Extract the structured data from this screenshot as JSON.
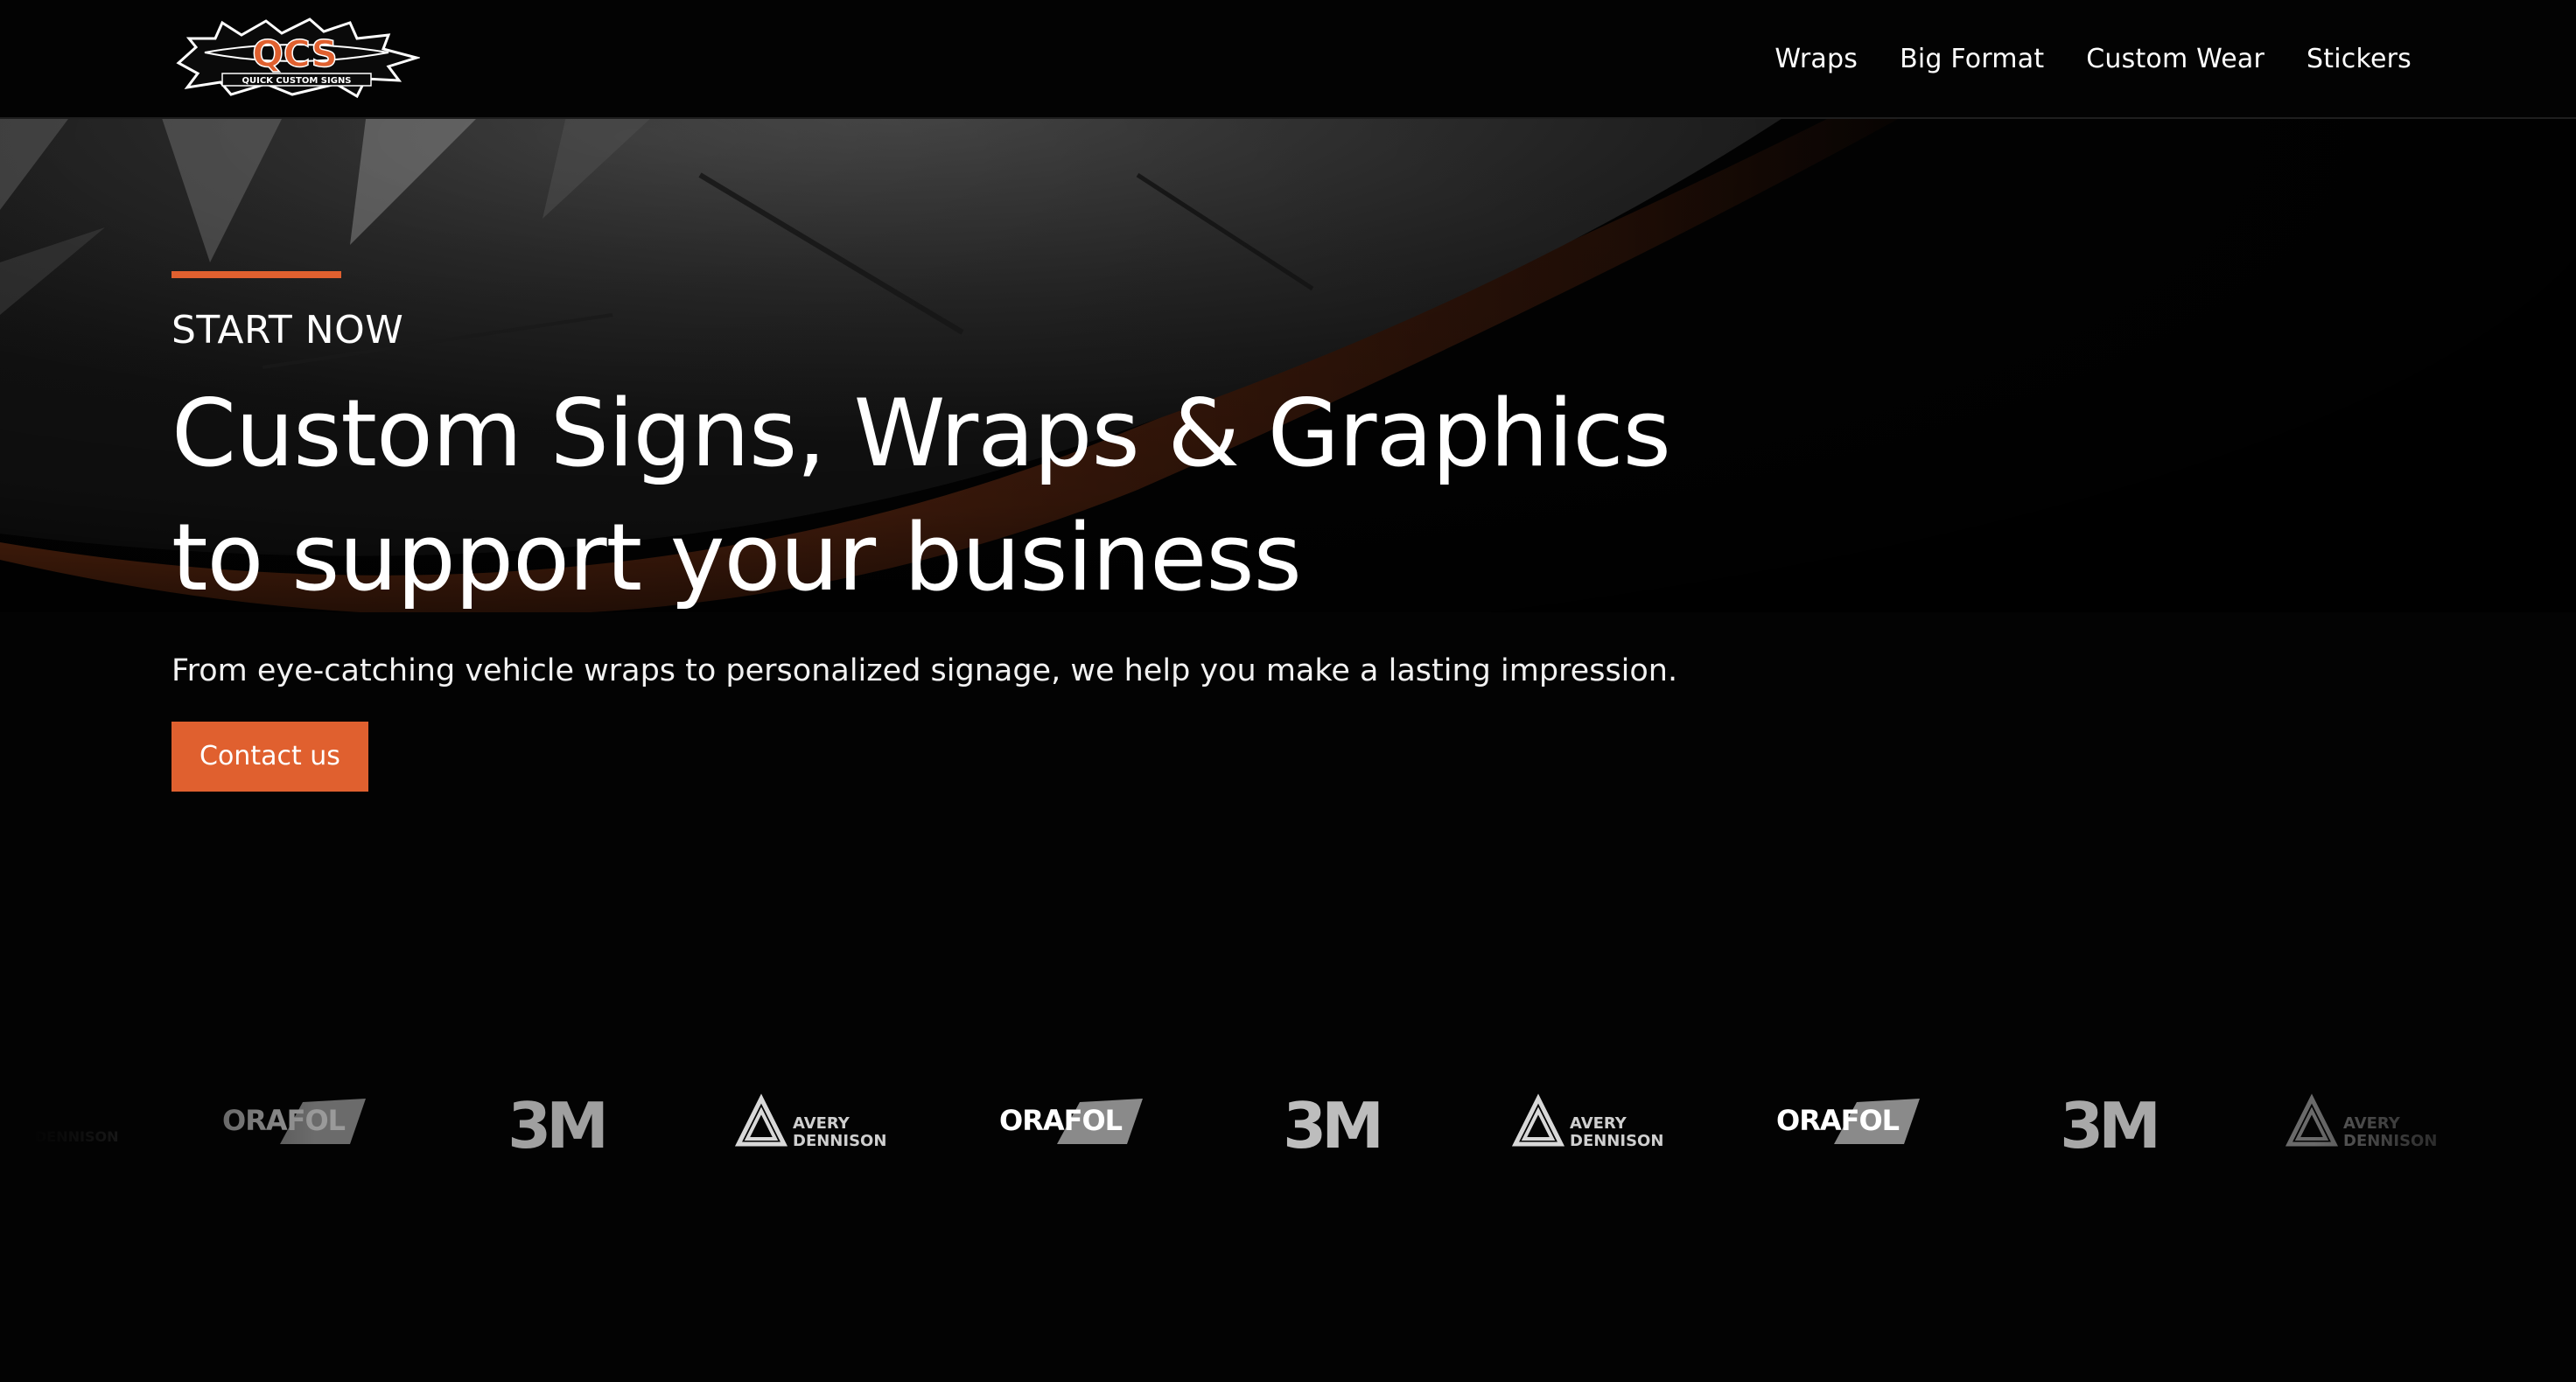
{
  "brand": {
    "logo_text": "QCS",
    "logo_subtext": "QUICK CUSTOM SIGNS"
  },
  "nav": {
    "items": [
      {
        "label": "Wraps"
      },
      {
        "label": "Big Format"
      },
      {
        "label": "Custom Wear"
      },
      {
        "label": "Stickers"
      }
    ]
  },
  "hero": {
    "eyebrow": "START NOW",
    "headline_line1": "Custom Signs, Wraps & Graphics",
    "headline_line2": "to support your business",
    "subtext": "From eye-catching vehicle wraps to personalized signage, we help you make a lasting impression.",
    "cta_label": "Contact us"
  },
  "partners": {
    "orafol": "ORAFOL",
    "threem": "3M",
    "avery_line1": "AVERY",
    "avery_line2": "DENNISON"
  },
  "colors": {
    "accent": "#e0602f",
    "background": "#030303",
    "text": "#ffffff"
  }
}
